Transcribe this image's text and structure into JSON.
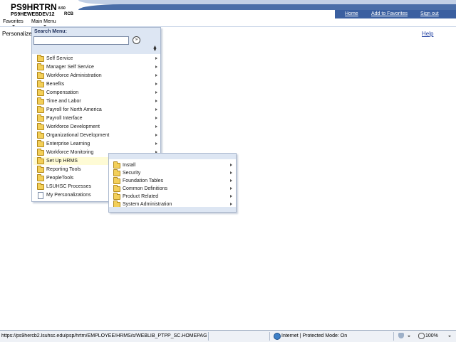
{
  "header": {
    "app_title": "PS9HRTRN",
    "app_version": "8.50",
    "database": "PS9HEWEBDEV12",
    "user": "RCB",
    "links": {
      "home": "Home",
      "add_favorites": "Add to Favorites",
      "sign_out": "Sign out"
    }
  },
  "menubar": {
    "favorites": "Favorites",
    "main_menu": "Main Menu"
  },
  "page": {
    "personalize": "Personalize",
    "help": "Help"
  },
  "search": {
    "label": "Search Menu:",
    "value": "",
    "go": "»"
  },
  "menu": {
    "items": [
      {
        "label": "Self Service"
      },
      {
        "label": "Manager Self Service"
      },
      {
        "label": "Workforce Administration"
      },
      {
        "label": "Benefits"
      },
      {
        "label": "Compensation"
      },
      {
        "label": "Time and Labor"
      },
      {
        "label": "Payroll for North America"
      },
      {
        "label": "Payroll Interface"
      },
      {
        "label": "Workforce Development"
      },
      {
        "label": "Organizational Development"
      },
      {
        "label": "Enterprise Learning"
      },
      {
        "label": "Workforce Monitoring"
      },
      {
        "label": "Set Up HRMS"
      },
      {
        "label": "Reporting Tools"
      },
      {
        "label": "PeopleTools"
      },
      {
        "label": "LSUHSC Processes"
      },
      {
        "label": "My Personalizations"
      }
    ]
  },
  "submenu": {
    "items": [
      {
        "label": "Install"
      },
      {
        "label": "Security"
      },
      {
        "label": "Foundation Tables"
      },
      {
        "label": "Common Definitions"
      },
      {
        "label": "Product Related"
      },
      {
        "label": "System Administration"
      }
    ]
  },
  "statusbar": {
    "url": "https://ps9hercb2.lsuhsc.edu/psp/hrtrn/EMPLOYEE/HRMS/s/WEBLIB_PTPP_SC.HOMEPAGE",
    "zone": "Internet | Protected Mode: On",
    "zoom": "100%"
  },
  "colors": {
    "header_blue": "#4a6ea8",
    "menu_bg": "#dde6f3",
    "active_row": "#fefbd5"
  }
}
